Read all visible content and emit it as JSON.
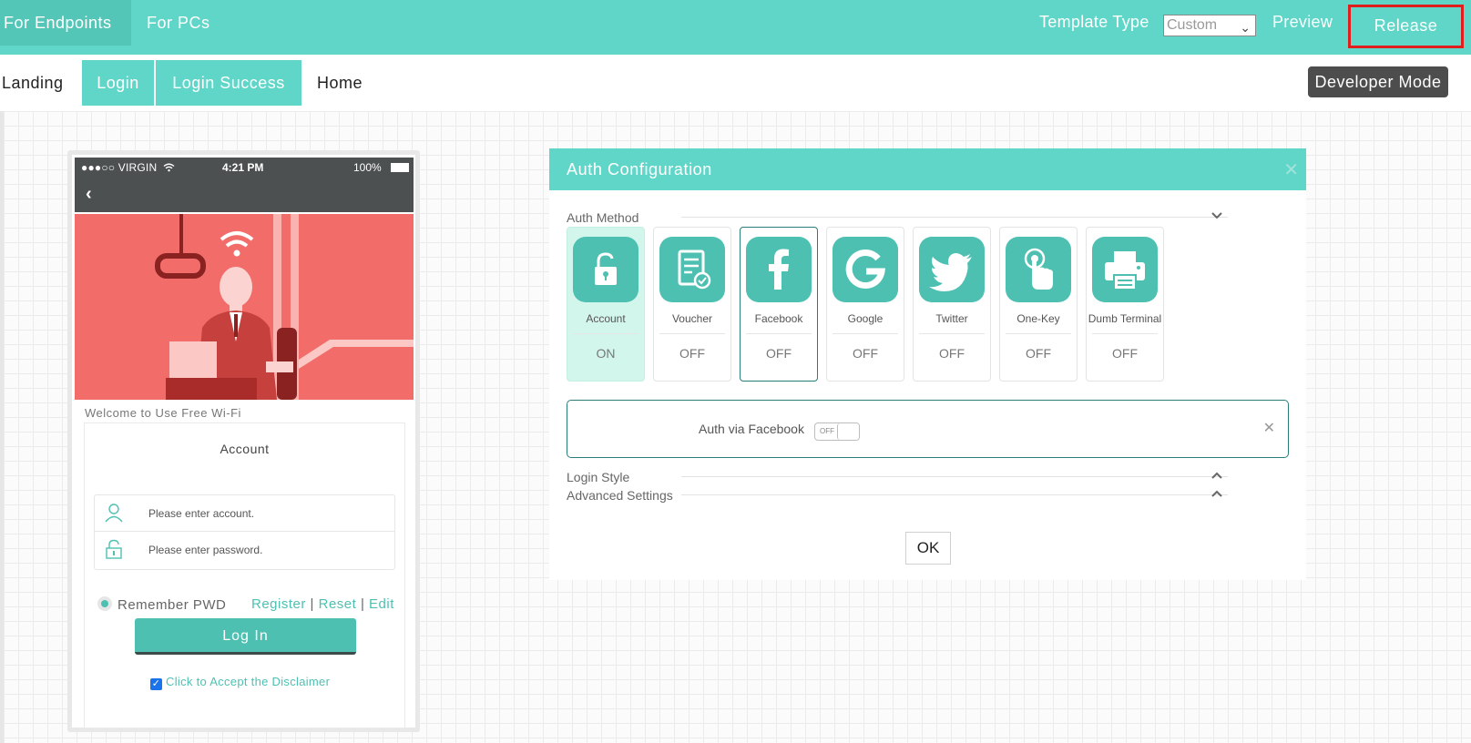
{
  "topbar": {
    "tab_endpoints": "For Endpoints",
    "tab_pcs": "For PCs",
    "template_type_label": "Template Type",
    "template_type_value": "Custom",
    "preview": "Preview",
    "release": "Release",
    "accent": "#5fd6c8",
    "highlight": "#e01e1e"
  },
  "pages": {
    "tabs": [
      {
        "label": "Landing",
        "active": false
      },
      {
        "label": "Login",
        "active": true
      },
      {
        "label": "Login Success",
        "active": true
      },
      {
        "label": "Home",
        "active": false
      }
    ],
    "developer_mode": "Developer Mode"
  },
  "phone": {
    "status": {
      "carrier": "●●●○○ VIRGIN",
      "time": "4:21 PM",
      "battery": "100%"
    },
    "back_icon": "chevron-left-icon",
    "welcome": "Welcome to Use Free Wi-Fi",
    "login_title": "Account",
    "account_placeholder": "Please enter account.",
    "password_placeholder": "Please enter password.",
    "remember": "Remember PWD",
    "links": {
      "register": "Register",
      "reset": "Reset",
      "edit": "Edit",
      "separator": "|"
    },
    "login_button": "Log In",
    "disclaimer": "Click to Accept the Disclaimer",
    "disclaimer_checked": true
  },
  "dialog": {
    "title": "Auth Configuration",
    "auth_method_label": "Auth Method",
    "methods": [
      {
        "name": "Account",
        "state": "ON",
        "icon": "lock-icon"
      },
      {
        "name": "Voucher",
        "state": "OFF",
        "icon": "voucher-icon"
      },
      {
        "name": "Facebook",
        "state": "OFF",
        "icon": "facebook-icon",
        "selected": true
      },
      {
        "name": "Google",
        "state": "OFF",
        "icon": "google-icon"
      },
      {
        "name": "Twitter",
        "state": "OFF",
        "icon": "twitter-icon"
      },
      {
        "name": "One-Key",
        "state": "OFF",
        "icon": "one-key-icon"
      },
      {
        "name": "Dumb Terminal",
        "state": "OFF",
        "icon": "printer-icon"
      }
    ],
    "facebook_setting_label": "Auth via Facebook",
    "facebook_toggle": "OFF",
    "login_style_label": "Login Style",
    "advanced_settings_label": "Advanced Settings",
    "ok": "OK"
  }
}
